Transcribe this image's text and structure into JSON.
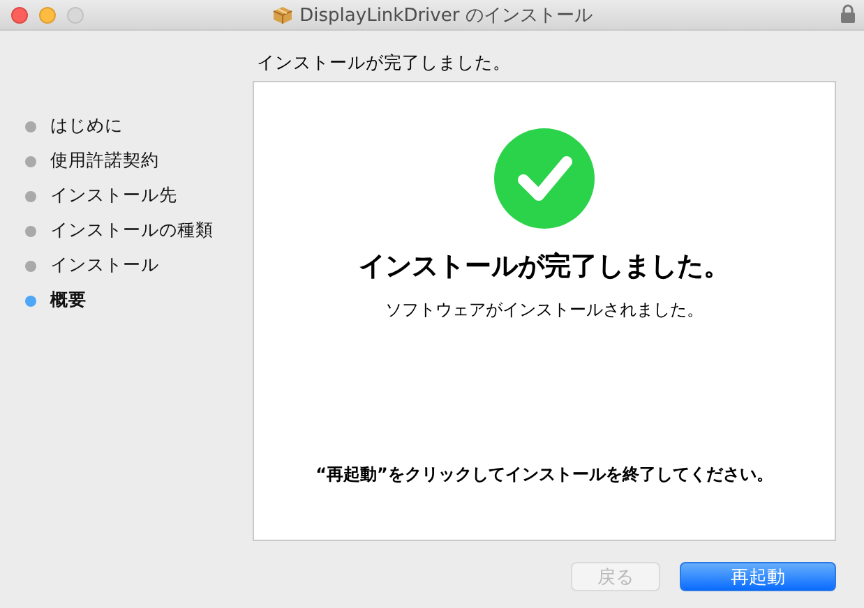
{
  "window": {
    "title": "DisplayLinkDriver のインストール"
  },
  "heading": "インストールが完了しました。",
  "steps": [
    {
      "label": "はじめに",
      "selected": false
    },
    {
      "label": "使用許諾契約",
      "selected": false
    },
    {
      "label": "インストール先",
      "selected": false
    },
    {
      "label": "インストールの種類",
      "selected": false
    },
    {
      "label": "インストール",
      "selected": false
    },
    {
      "label": "概要",
      "selected": true
    }
  ],
  "panel": {
    "title": "インストールが完了しました。",
    "subtitle": "ソフトウェアがインストールされました。",
    "note": "“再起動”をクリックしてインストールを終了してください。"
  },
  "buttons": [
    {
      "label": "戻る",
      "kind": "secondary",
      "disabled": true
    },
    {
      "label": "再起動",
      "kind": "primary",
      "disabled": false
    }
  ]
}
